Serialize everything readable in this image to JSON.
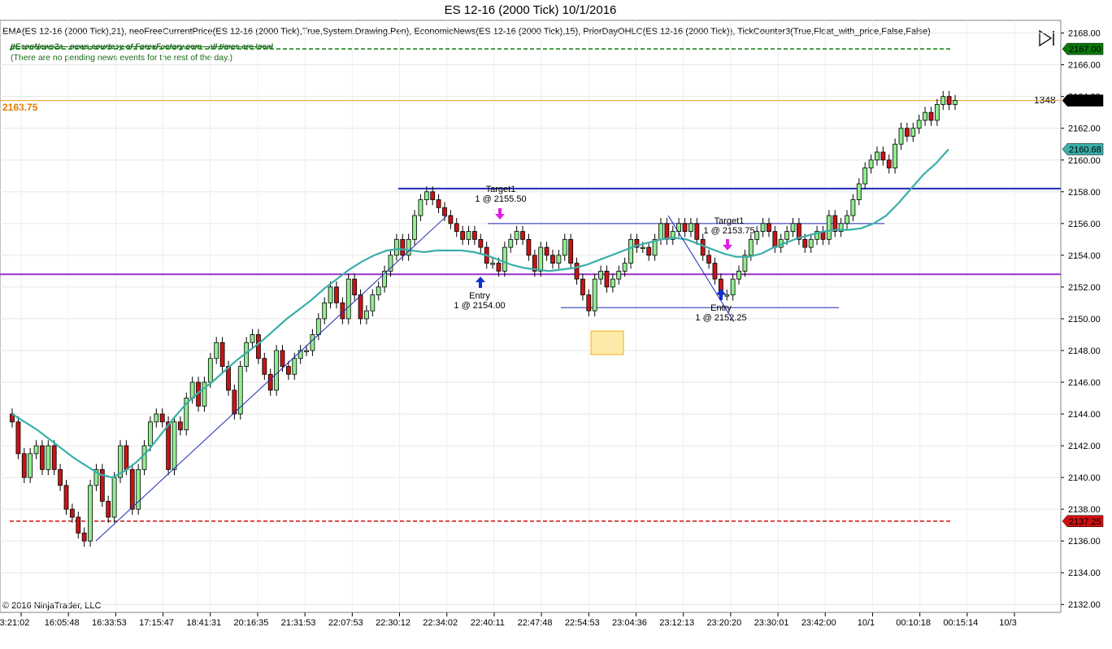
{
  "header": {
    "title": "ES 12-16 (2000 Tick)  10/1/2016",
    "indicators": "EMA(ES 12-16 (2000 Tick),21), neoFreeCurrentPrice(ES 12-16 (2000 Tick),True,System.Drawing.Pen), EconomicNews(ES 12-16 (2000 Tick),15), PriorDayOHLC(ES 12-16 (2000 Tick)), TickCounter3(True,Float_with_price,False,False)",
    "news_source": "jtEconNews2a - news courtesy of ForexFactory.com - all times are local",
    "news_status": "(There are no pending news events for the rest of the day.)"
  },
  "footer": {
    "copyright": "© 2016 NinjaTrader, LLC"
  },
  "overlay": {
    "left_price": "2163.75",
    "tick_counter": "1348"
  },
  "colors": {
    "up_candle": "#90ee90",
    "down_candle": "#c81414",
    "ema": "#3aafa9",
    "prior_high": "#0a7a0a",
    "prior_low": "#d01010",
    "prior_mid": "#9b30c8",
    "current_price": "#f0a020",
    "trendline": "#1e2ab4"
  },
  "chart_data": {
    "type": "candlestick",
    "title": "ES 12-16 (2000 Tick)  10/1/2016",
    "ylim": [
      2131.5,
      2168.8
    ],
    "y_ticks": [
      2132,
      2134,
      2136,
      2138,
      2140,
      2142,
      2144,
      2146,
      2148,
      2150,
      2152,
      2154,
      2156,
      2158,
      2160,
      2162,
      2164,
      2166,
      2168
    ],
    "x_labels": [
      "3:21:02",
      "16:05:48",
      "16:33:53",
      "17:15:47",
      "18:41:31",
      "20:16:35",
      "21:31:53",
      "22:07:53",
      "22:30:12",
      "22:34:02",
      "22:40:11",
      "22:47:48",
      "22:54:53",
      "23:04:36",
      "23:12:13",
      "23:20:20",
      "23:30:01",
      "23:42:00",
      "10/1",
      "00:10:18",
      "00:15:14",
      "10/3"
    ],
    "price_badges": [
      {
        "label": "2167.00",
        "value": 2167.0,
        "color": "#0a7a0a"
      },
      {
        "label": "2163.75",
        "value": 2163.75,
        "color": "#000000"
      },
      {
        "label": "2160.68",
        "value": 2160.68,
        "color": "#3aafa9"
      },
      {
        "label": "2137.25",
        "value": 2137.25,
        "color": "#d01010"
      }
    ],
    "levels": [
      {
        "name": "prior-day-high",
        "value": 2167.0
      },
      {
        "name": "current-price",
        "value": 2163.75
      },
      {
        "name": "resistance",
        "value": 2158.2
      },
      {
        "name": "prior-day-mid",
        "value": 2152.8
      },
      {
        "name": "prior-day-low",
        "value": 2137.25
      }
    ],
    "annotations": [
      {
        "label": "Target1",
        "sub": "1 @ 2155.50",
        "value": 2155.5
      },
      {
        "label": "Entry",
        "sub": "1 @ 2154.00",
        "value": 2154.0
      },
      {
        "label": "Target1",
        "sub": "1 @ 2153.75",
        "value": 2153.75
      },
      {
        "label": "Entry",
        "sub": "1 @ 2152.25",
        "value": 2152.25
      }
    ],
    "close": [
      2143.5,
      2141.5,
      2140.0,
      2141.5,
      2142.0,
      2140.5,
      2142.0,
      2140.5,
      2139.5,
      2138.0,
      2137.5,
      2136.5,
      2136.0,
      2139.5,
      2140.5,
      2138.5,
      2137.5,
      2140.0,
      2142.0,
      2140.5,
      2138.0,
      2140.5,
      2142.0,
      2143.5,
      2144.0,
      2143.5,
      2140.5,
      2143.5,
      2143.0,
      2145.0,
      2146.0,
      2144.5,
      2146.0,
      2147.5,
      2148.5,
      2147.0,
      2145.5,
      2144.0,
      2147.0,
      2148.5,
      2149.0,
      2147.5,
      2146.5,
      2145.5,
      2148.0,
      2147.0,
      2146.5,
      2147.5,
      2148.0,
      2148.0,
      2149.0,
      2150.0,
      2151.0,
      2152.0,
      2151.0,
      2150.0,
      2152.5,
      2151.5,
      2150.0,
      2150.5,
      2151.5,
      2152.0,
      2153.0,
      2154.0,
      2155.0,
      2154.0,
      2155.0,
      2156.5,
      2157.5,
      2158.0,
      2157.5,
      2157.0,
      2156.5,
      2156.0,
      2155.5,
      2155.0,
      2155.5,
      2155.0,
      2154.5,
      2153.5,
      2153.5,
      2153.0,
      2154.5,
      2155.0,
      2155.5,
      2155.0,
      2154.0,
      2153.0,
      2154.5,
      2154.0,
      2153.5,
      2154.0,
      2155.0,
      2153.5,
      2152.5,
      2151.5,
      2150.5,
      2152.5,
      2153.0,
      2152.0,
      2152.5,
      2153.0,
      2153.5,
      2155.0,
      2154.5,
      2154.5,
      2154.0,
      2155.0,
      2156.0,
      2155.0,
      2155.5,
      2156.0,
      2155.5,
      2156.0,
      2155.0,
      2154.0,
      2153.5,
      2152.5,
      2151.5,
      2151.5,
      2152.5,
      2153.0,
      2154.0,
      2155.0,
      2155.5,
      2156.0,
      2155.5,
      2154.5,
      2155.0,
      2155.5,
      2156.0,
      2155.0,
      2154.5,
      2155.0,
      2155.5,
      2155.0,
      2156.5,
      2155.5,
      2156.0,
      2156.5,
      2157.5,
      2158.5,
      2159.5,
      2160.0,
      2160.5,
      2160.0,
      2159.5,
      2161.0,
      2162.0,
      2161.5,
      2162.0,
      2162.5,
      2163.0,
      2162.5,
      2163.5,
      2164.0,
      2163.5,
      2163.75
    ],
    "ema": [
      2144.0,
      2143.5,
      2143.0,
      2142.4,
      2141.8,
      2141.2,
      2140.7,
      2140.2,
      2140.0,
      2140.4,
      2141.0,
      2141.8,
      2142.8,
      2143.8,
      2144.7,
      2145.4,
      2146.0,
      2146.7,
      2147.4,
      2148.0,
      2148.6,
      2149.3,
      2150.0,
      2150.6,
      2151.2,
      2151.9,
      2152.5,
      2153.1,
      2153.6,
      2154.0,
      2154.3,
      2154.4,
      2154.3,
      2154.2,
      2154.3,
      2154.3,
      2154.3,
      2154.2,
      2154.0,
      2153.7,
      2153.4,
      2153.2,
      2153.1,
      2153.0,
      2153.1,
      2153.2,
      2153.4,
      2153.7,
      2154.0,
      2154.3,
      2154.6,
      2154.8,
      2155.0,
      2155.1,
      2155.0,
      2154.7,
      2154.4,
      2154.1,
      2153.9,
      2153.9,
      2154.1,
      2154.5,
      2154.8,
      2155.1,
      2155.3,
      2155.5,
      2155.6,
      2155.6,
      2155.7,
      2156.0,
      2156.5,
      2157.3,
      2158.2,
      2159.1,
      2159.8,
      2160.68
    ]
  }
}
